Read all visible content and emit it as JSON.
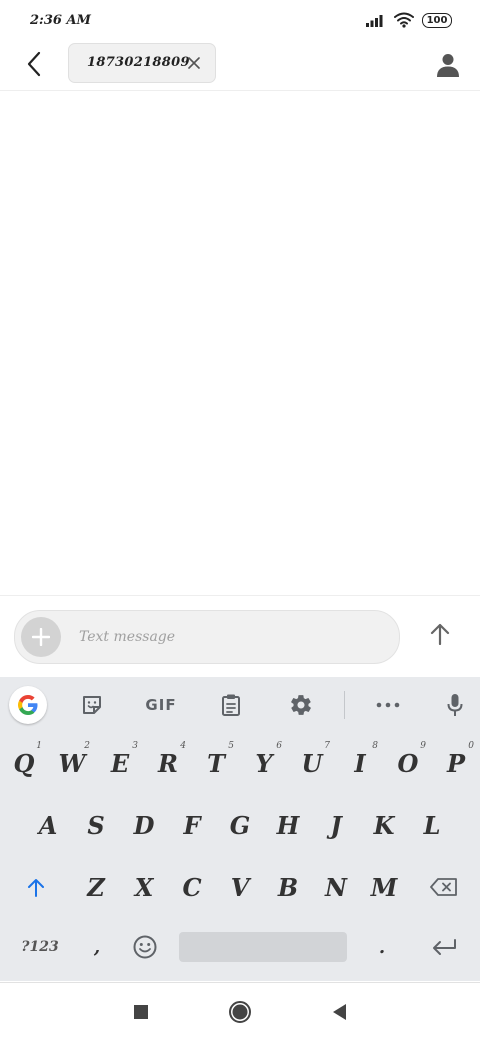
{
  "status_bar": {
    "time": "2:36 AM",
    "battery": "100"
  },
  "header": {
    "recipient": "18730218809"
  },
  "compose": {
    "placeholder": "Text message"
  },
  "keyboard": {
    "toolbar": {
      "gif_label": "GIF"
    },
    "row1": [
      {
        "letter": "Q",
        "hint": "1"
      },
      {
        "letter": "W",
        "hint": "2"
      },
      {
        "letter": "E",
        "hint": "3"
      },
      {
        "letter": "R",
        "hint": "4"
      },
      {
        "letter": "T",
        "hint": "5"
      },
      {
        "letter": "Y",
        "hint": "6"
      },
      {
        "letter": "U",
        "hint": "7"
      },
      {
        "letter": "I",
        "hint": "8"
      },
      {
        "letter": "O",
        "hint": "9"
      },
      {
        "letter": "P",
        "hint": "0"
      }
    ],
    "row2": [
      "A",
      "S",
      "D",
      "F",
      "G",
      "H",
      "J",
      "K",
      "L"
    ],
    "row3": [
      "Z",
      "X",
      "C",
      "V",
      "B",
      "N",
      "M"
    ],
    "row4": {
      "symbols": "?123",
      "comma": ",",
      "period": "."
    }
  },
  "colors": {
    "shift_arrow": "#1a73e8",
    "keyboard_bg": "#e8eaed"
  }
}
